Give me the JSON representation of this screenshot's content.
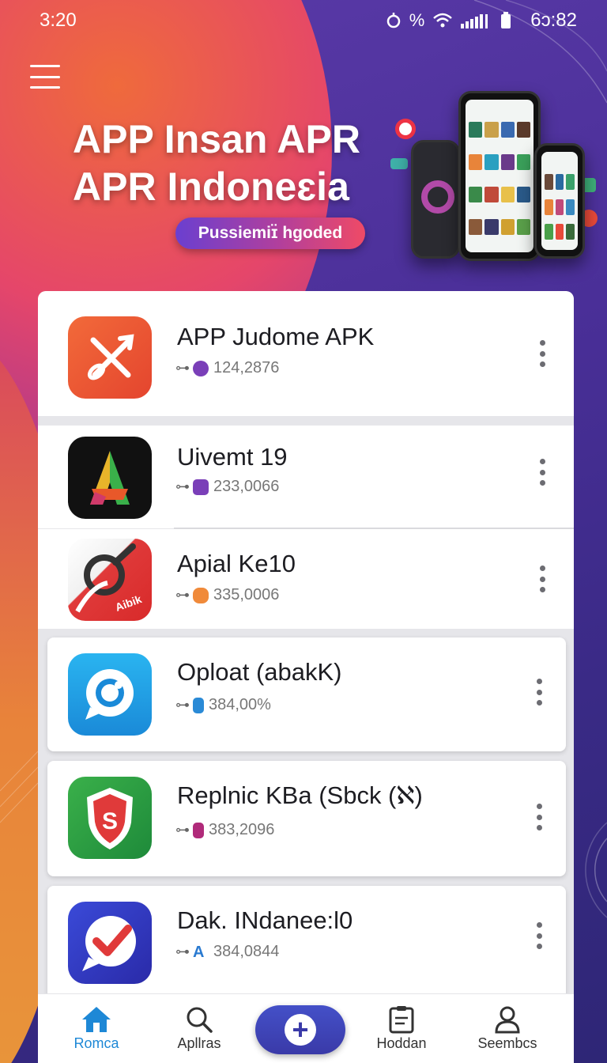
{
  "status_bar": {
    "time": "3:20",
    "right_text": "6ɔ:82",
    "percent_glyph": "%"
  },
  "hero": {
    "title_line1": "APP Insan APR",
    "title_line2": "APR Indoneɛia",
    "pill_label": "Pussiemiɪ̈ hgoded"
  },
  "apps": [
    {
      "title": "APP Judome APK",
      "meta": "124,2876",
      "icon": "cross-arrow-icon",
      "badge_color": "#7a3fb8"
    },
    {
      "title": "Uivemt 19",
      "meta": "233,0066",
      "icon": "letter-a-icon",
      "badge_color": "#7a3fb8"
    },
    {
      "title": "Apial Ke10",
      "meta": "335,0006",
      "icon": "ring-brush-icon",
      "badge_color": "#f08a3a"
    },
    {
      "title": "Oploat (abakK)",
      "meta": "384,00%",
      "icon": "chat-bubble-icon",
      "badge_color": "#2a8ad6"
    },
    {
      "title": "Replnic KBa (Sbck (ℵ)",
      "meta": "383,2096",
      "icon": "shield-s-icon",
      "badge_color": "#b02a7a"
    },
    {
      "title": "Dak. INdanee:l0",
      "meta": "384,0844",
      "icon": "checkmark-bubble-icon",
      "badge_color": "#2a7ad0"
    }
  ],
  "nav": {
    "home": "Romca",
    "search": "Apllras",
    "fab": "+",
    "docs": "Hoddan",
    "profile": "Seembcs"
  },
  "colors": {
    "accent": "#1e88d6",
    "fab": "#3a3aa8",
    "hero_pill_start": "#6a3fd0",
    "hero_pill_end": "#ef4a66"
  }
}
